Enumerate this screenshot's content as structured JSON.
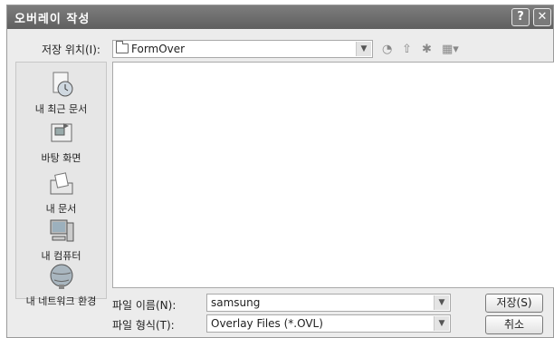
{
  "window": {
    "title": "오버레이 작성",
    "help_label": "?",
    "close_label": "✕"
  },
  "location": {
    "label": "저장 위치(I):",
    "value": "FormOver"
  },
  "toolbar": {
    "back": "◔",
    "up": "⇧",
    "new_folder": "✱",
    "view": "▦▾"
  },
  "places": [
    {
      "label": "내 최근 문서",
      "icon": "recent-documents-icon"
    },
    {
      "label": "바탕 화면",
      "icon": "desktop-icon"
    },
    {
      "label": "내 문서",
      "icon": "my-documents-icon"
    },
    {
      "label": "내 컴퓨터",
      "icon": "my-computer-icon"
    },
    {
      "label": "내 네트워크 환경",
      "icon": "network-icon"
    }
  ],
  "filename": {
    "label": "파일 이름(N):",
    "value": "samsung"
  },
  "filetype": {
    "label": "파일 형식(T):",
    "value": "Overlay Files (*.OVL)"
  },
  "buttons": {
    "save": "저장(S)",
    "cancel": "취소"
  }
}
